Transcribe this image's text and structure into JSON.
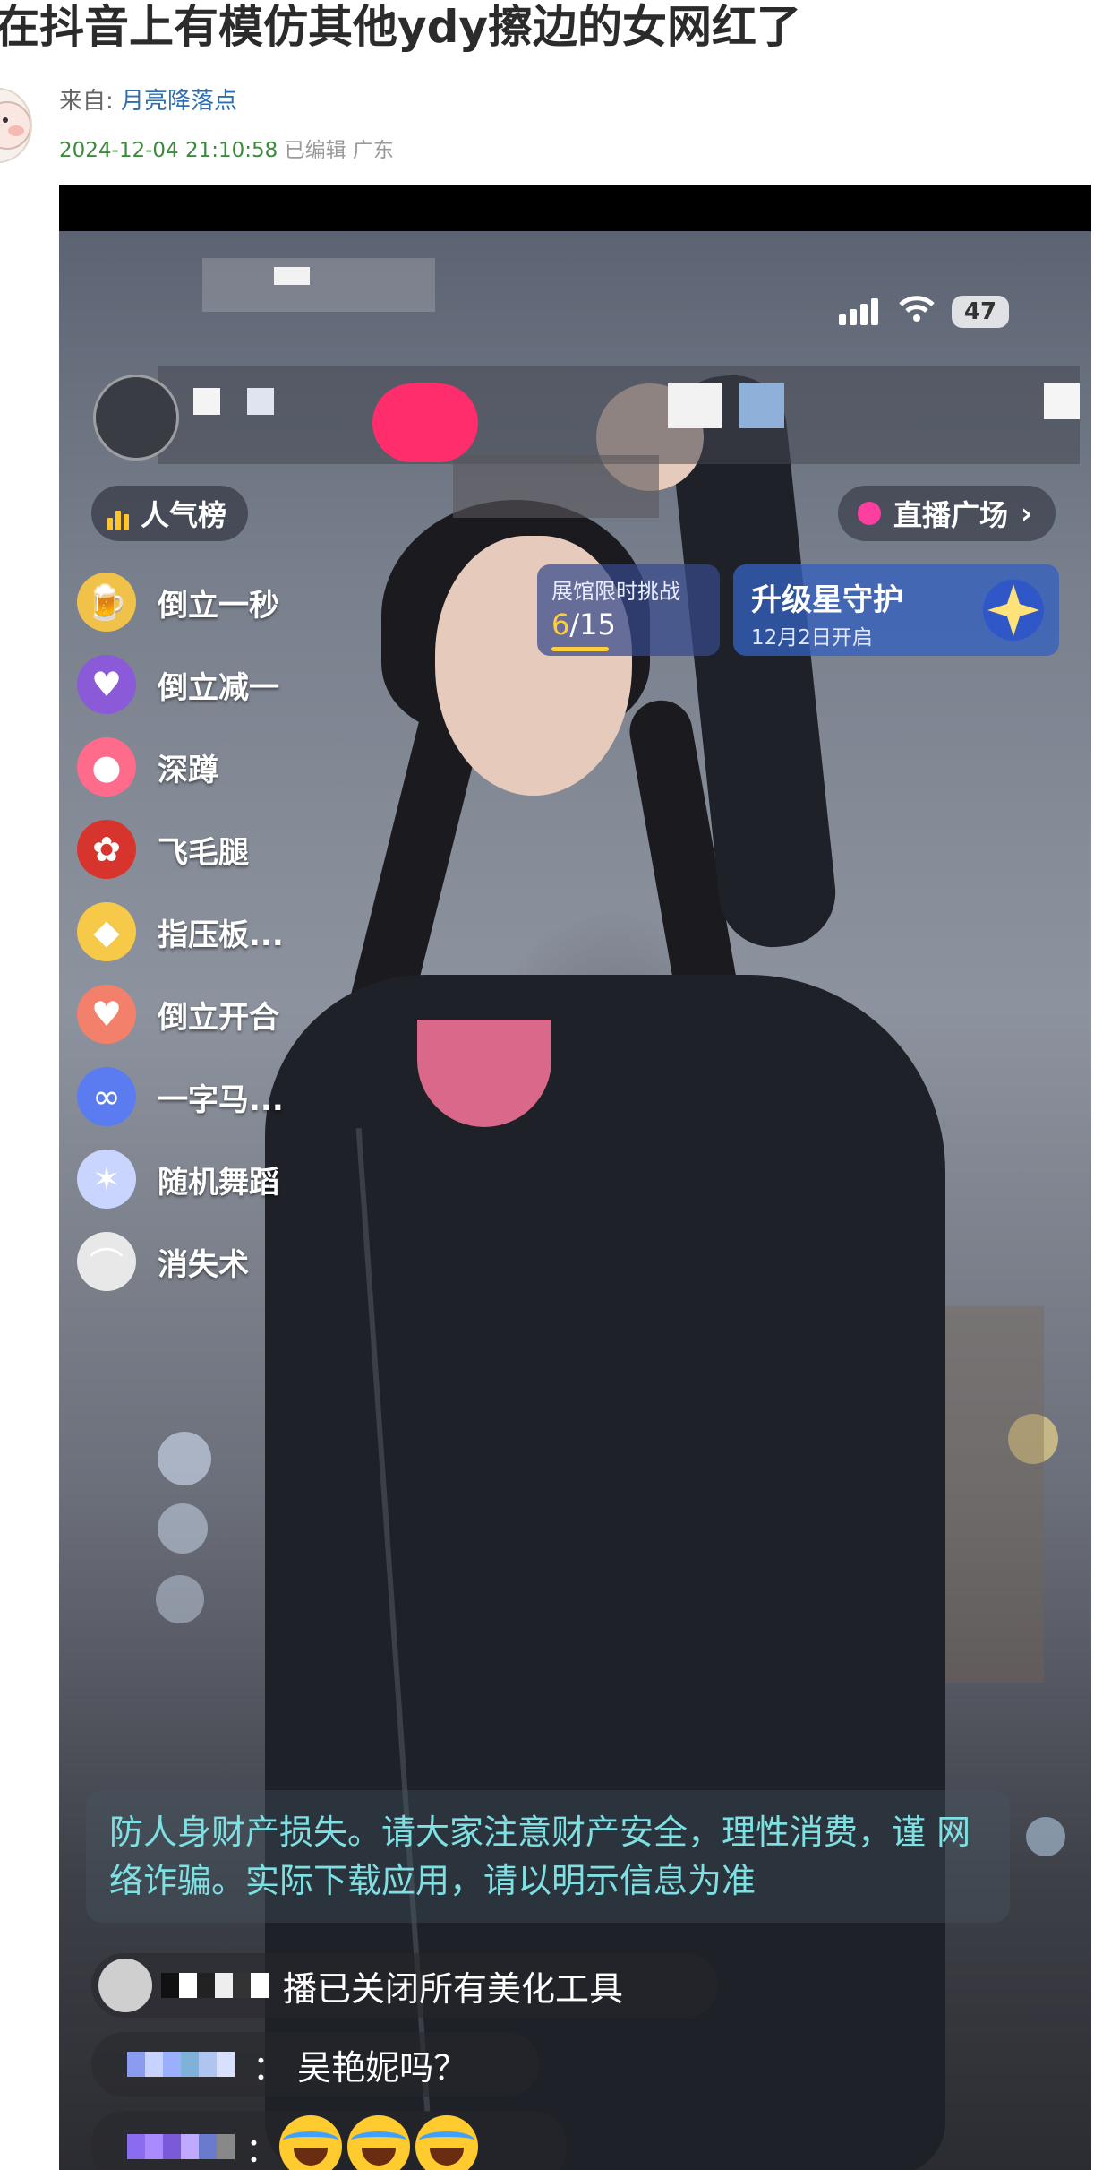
{
  "post": {
    "title": "在抖音上有模仿其他ydy擦边的女网红了",
    "from_label": "来自: ",
    "author": "月亮降落点",
    "datetime": "2024-12-04 21:10:58",
    "edited": "已编辑",
    "location": "广东"
  },
  "live": {
    "battery": "47",
    "popularity_chip": "人气榜",
    "plaza_chip": "直播广场",
    "plaza_arrow": "›",
    "challenge": {
      "title": "展馆限时挑战",
      "current": "6",
      "total": "/15"
    },
    "guard": {
      "title": "升级星守护",
      "subtitle": "12月2日开启"
    },
    "gifts": [
      {
        "label": "倒立一秒",
        "icon": "beer-mug-icon",
        "color": "#f0c24a"
      },
      {
        "label": "倒立减一",
        "icon": "purple-heart-badge-icon",
        "color": "#8a5ad8"
      },
      {
        "label": "深蹲",
        "icon": "lollipop-icon",
        "color": "#ff6b8a"
      },
      {
        "label": "飞毛腿",
        "icon": "rose-bouquet-icon",
        "color": "#d8342e"
      },
      {
        "label": "指压板...",
        "icon": "duck-icon",
        "color": "#f7c948"
      },
      {
        "label": "倒立开合",
        "icon": "peach-icon",
        "color": "#f3806a"
      },
      {
        "label": "一字马...",
        "icon": "sunglasses-icon",
        "color": "#5a7cf0"
      },
      {
        "label": "随机舞蹈",
        "icon": "sparkle-icon",
        "color": "#c9d4ff"
      },
      {
        "label": "消失术",
        "icon": "magic-hat-icon",
        "color": "#e8e8e8"
      }
    ],
    "notice": "防人身财产损失。请大家注意财产安全，理性消费，谨   网络诈骗。实际下载应用，请以明示信息为准",
    "comments": [
      {
        "text": "播已关闭所有美化工具"
      },
      {
        "text": "：  吴艳妮吗？"
      },
      {
        "text": "："
      }
    ]
  }
}
